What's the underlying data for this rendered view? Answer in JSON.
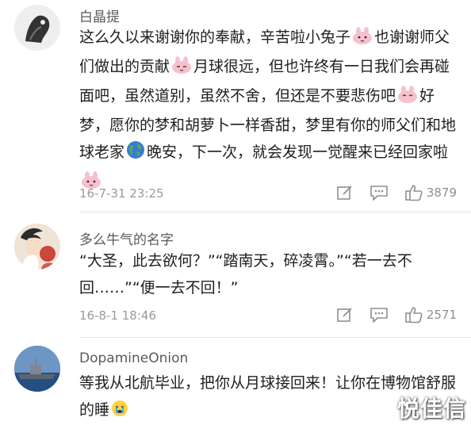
{
  "comments": [
    {
      "username": "白晶提",
      "text_parts": [
        "这么久以来谢谢你的奉献，辛苦啦小兔子",
        "也谢谢师父们做出的贡献",
        "月球很远，但也许终有一日我们会再碰面吧，虽然道别，虽然不舍，但还是不要悲伤吧",
        "好梦，愿你的梦和胡萝卜一样香甜，梦里有你的师父们和地球老家",
        "晚安，下一次，就会发现一觉醒来已经回家啦"
      ],
      "emoji_names": [
        "rabbit-emoji",
        "rabbit-emoji",
        "rabbit-emoji",
        "earth-emoji",
        "rabbit-emoji"
      ],
      "timestamp": "16-7-31 23:25",
      "likes": "3879"
    },
    {
      "username": "多么牛气的名字",
      "text": "“大圣，此去欲何？”“踏南天，碎凌霄。”“若一去不回……”“便一去不回！”",
      "timestamp": "16-8-1 18:46",
      "likes": "2571"
    },
    {
      "username": "DopamineOnion",
      "text_parts": [
        "等我从北航毕业，把你从月球接回来！让你在博物馆舒服的睡"
      ],
      "emoji_names": [
        "crying-emoji"
      ]
    }
  ],
  "icons": {
    "edit": "edit-icon",
    "comment": "comment-icon",
    "like": "thumbs-up-icon"
  },
  "watermark": "悦佳信"
}
